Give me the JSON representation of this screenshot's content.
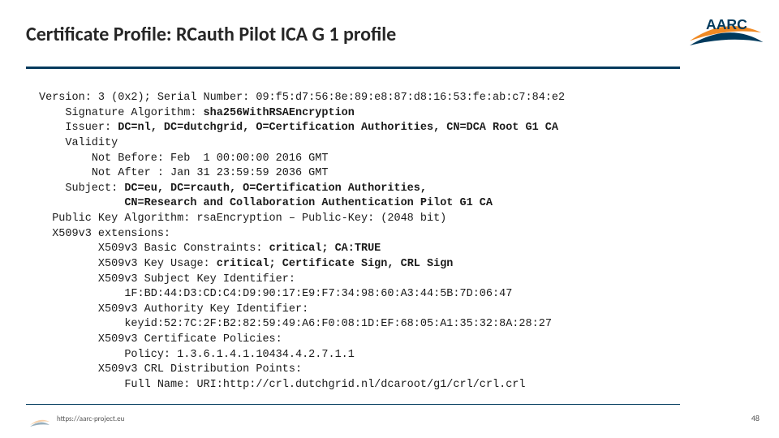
{
  "brand": "AARC",
  "title": "Certificate Profile: RCauth Pilot ICA G 1 profile",
  "footer_url": "https://aarc-project.eu",
  "page_number": "48",
  "cert": {
    "version": "Version: 3 (0x2); Serial Number: 09:f5:d7:56:8e:89:e8:87:d8:16:53:fe:ab:c7:84:e2",
    "sigalg_label": "Signature Algorithm: ",
    "sigalg_value": "sha256WithRSAEncryption",
    "issuer_label": "Issuer: ",
    "issuer_value": "DC=nl, DC=dutchgrid, O=Certification Authorities, CN=DCA Root G1 CA",
    "validity_label": "Validity",
    "not_before": "Not Before: Feb  1 00:00:00 2016 GMT",
    "not_after": "Not After : Jan 31 23:59:59 2036 GMT",
    "subject_label": "Subject: ",
    "subject_l1": "DC=eu, DC=rcauth, O=Certification Authorities,",
    "subject_l2": "CN=Research and Collaboration Authentication Pilot G1 CA",
    "pubkey_line": "Public Key Algorithm: rsaEncryption – Public-Key: (2048 bit)",
    "ext_header": "X509v3 extensions:",
    "bc_label": "X509v3 Basic Constraints: ",
    "bc_value": "critical; CA:TRUE",
    "ku_label": "X509v3 Key Usage: ",
    "ku_value": "critical; Certificate Sign, CRL Sign",
    "ski_label": "X509v3 Subject Key Identifier:",
    "ski_value": "1F:BD:44:D3:CD:C4:D9:90:17:E9:F7:34:98:60:A3:44:5B:7D:06:47",
    "aki_label": "X509v3 Authority Key Identifier:",
    "aki_value": "keyid:52:7C:2F:B2:82:59:49:A6:F0:08:1D:EF:68:05:A1:35:32:8A:28:27",
    "pol_label": "X509v3 Certificate Policies:",
    "pol_value": "Policy: 1.3.6.1.4.1.10434.4.2.7.1.1",
    "crl_label": "X509v3 CRL Distribution Points:",
    "crl_value": "Full Name: URI:http://crl.dutchgrid.nl/dcaroot/g1/crl/crl.crl"
  }
}
